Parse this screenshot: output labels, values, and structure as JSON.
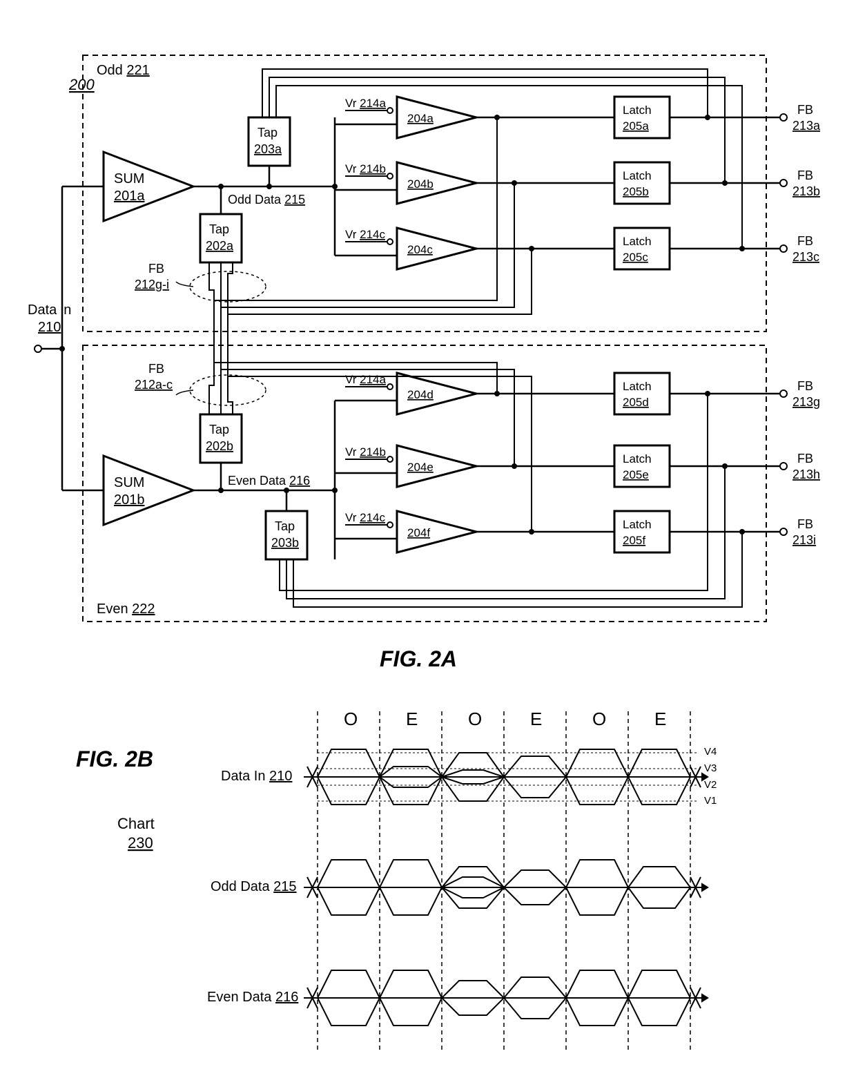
{
  "fig2a": {
    "title": "FIG. 2A",
    "circuit_ref": "200",
    "odd_label": "Odd",
    "odd_ref": "221",
    "even_label": "Even",
    "even_ref": "222",
    "data_in_label": "Data in",
    "data_in_ref": "210",
    "sum_a_label": "SUM",
    "sum_a_ref": "201a",
    "sum_b_label": "SUM",
    "sum_b_ref": "201b",
    "tap_203a_label": "Tap",
    "tap_203a_ref": "203a",
    "tap_202a_label": "Tap",
    "tap_202a_ref": "202a",
    "tap_202b_label": "Tap",
    "tap_202b_ref": "202b",
    "tap_203b_label": "Tap",
    "tap_203b_ref": "203b",
    "odd_data_label": "Odd Data",
    "odd_data_ref": "215",
    "even_data_label": "Even Data",
    "even_data_ref": "216",
    "vr_a_label": "Vr",
    "vr_a_ref": "214a",
    "vr_b_label": "Vr",
    "vr_b_ref": "214b",
    "vr_c_label": "Vr",
    "vr_c_ref": "214c",
    "comp_204a": "204a",
    "comp_204b": "204b",
    "comp_204c": "204c",
    "comp_204d": "204d",
    "comp_204e": "204e",
    "comp_204f": "204f",
    "latch_label": "Latch",
    "latch_205a": "205a",
    "latch_205b": "205b",
    "latch_205c": "205c",
    "latch_205d": "205d",
    "latch_205e": "205e",
    "latch_205f": "205f",
    "fb_label": "FB",
    "fb_213a": "213a",
    "fb_213b": "213b",
    "fb_213c": "213c",
    "fb_213g": "213g",
    "fb_213h": "213h",
    "fb_213i": "213i",
    "fb_212gi_label": "FB",
    "fb_212gi_ref": "212g-i",
    "fb_212ac_label": "FB",
    "fb_212ac_ref": "212a-c"
  },
  "fig2b": {
    "title": "FIG. 2B",
    "chart_label": "Chart",
    "chart_ref": "230",
    "data_in_label": "Data In",
    "data_in_ref": "210",
    "odd_data_label": "Odd Data",
    "odd_data_ref": "215",
    "even_data_label": "Even Data",
    "even_data_ref": "216",
    "col_O": "O",
    "col_E": "E",
    "v1": "V1",
    "v2": "V2",
    "v3": "V3",
    "v4": "V4"
  },
  "chart_data": {
    "type": "timing-diagram",
    "title": "FIG. 2B eye-diagram style timing chart",
    "time_slots": [
      "O",
      "E",
      "O",
      "E",
      "O",
      "E"
    ],
    "voltage_levels": [
      "V1",
      "V2",
      "V3",
      "V4"
    ],
    "signals": [
      {
        "name": "Data In 210",
        "description": "PAM-4 eye diagram over six UI showing all transitions, with reference levels V1..V4"
      },
      {
        "name": "Odd Data 215",
        "description": "Odd-slice sampled eye diagram across same six UI"
      },
      {
        "name": "Even Data 216",
        "description": "Even-slice sampled eye diagram across same six UI"
      }
    ]
  }
}
